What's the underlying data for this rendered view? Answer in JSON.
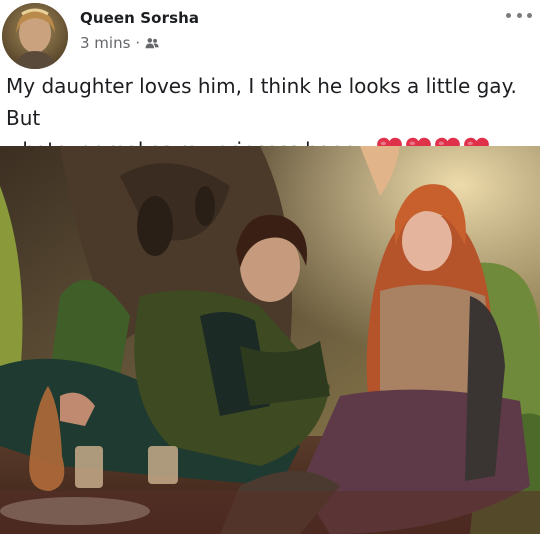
{
  "post": {
    "author": "Queen Sorsha",
    "time": "3 mins",
    "separator": "·",
    "audience_icon": "friends-icon",
    "more_icon": "more-options-icon",
    "text_line1": "My daughter loves him, I think he looks a little gay. But",
    "text_line2": "whatever makes my princess happy",
    "reaction_hearts": 4,
    "heart_color": "#e0314b"
  },
  "photo": {
    "description_icon": "photo"
  },
  "colors": {
    "text_primary": "#1c1e21",
    "text_secondary": "#65676b",
    "background": "#ffffff"
  }
}
